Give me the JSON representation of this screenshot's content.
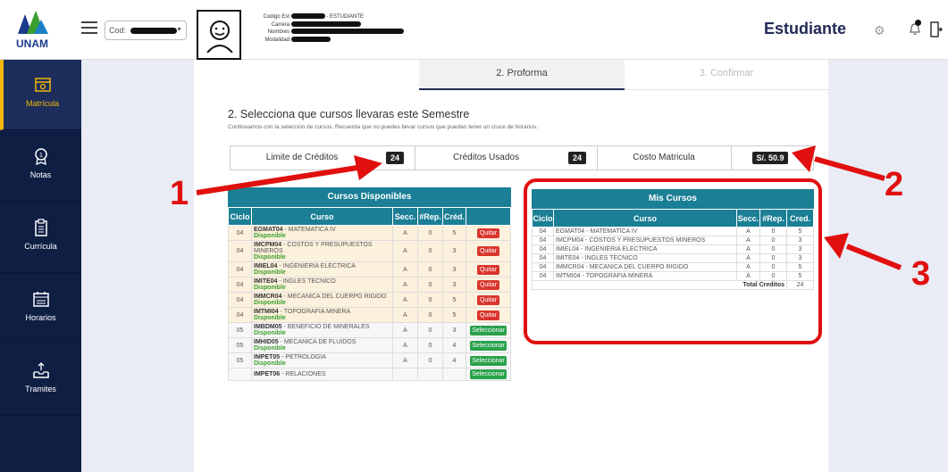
{
  "header": {
    "logo_text": "UNAM",
    "cod_label": "Cod:",
    "info": {
      "codigo_label": "Codigo Est",
      "codigo_suffix": "- ESTUDIANTE",
      "carrera_label": "Carrera",
      "nombres_label": "Nombres",
      "modalidad_label": "Modalidad"
    },
    "role": "Estudiante",
    "bell_count": "1"
  },
  "sidebar": {
    "items": [
      {
        "label": "Matrícula",
        "icon": "register-icon",
        "active": true
      },
      {
        "label": "Notas",
        "icon": "grade-medal-icon",
        "active": false
      },
      {
        "label": "Currícula",
        "icon": "clipboard-icon",
        "active": false
      },
      {
        "label": "Horarios",
        "icon": "calendar-icon",
        "active": false
      },
      {
        "label": "Tramites",
        "icon": "inbox-tray-icon",
        "active": false
      }
    ]
  },
  "steps": [
    "",
    "2. Proforma",
    "3. Confirmar"
  ],
  "section": {
    "title": "2. Selecciona que cursos llevaras este Semestre",
    "subtitle": "Continuamos con la seleccion de cursos. Recuerda que no puedes llevar cursos que puedan tener un cruce de horarios."
  },
  "credits": {
    "limit_label": "Limite de Créditos",
    "limit_value": "24",
    "used_label": "Créditos Usados",
    "used_value": "24",
    "cost_label": "Costo Matricula",
    "cost_value": "S/. 50.9"
  },
  "disponibles": {
    "title": "Cursos Disponibles",
    "columns": [
      "Ciclo",
      "Curso",
      "Secc.",
      "#Rep.",
      "Créd.",
      ""
    ],
    "status_text": "Disponible",
    "quitar_label": "Quitar",
    "select_label": "Seleccionar",
    "rows": [
      {
        "ciclo": "04",
        "code": "EGMAT04",
        "name": " - MATEMATICA IV",
        "secc": "A",
        "rep": "0",
        "cred": "5",
        "action": "Quitar"
      },
      {
        "ciclo": "04",
        "code": "IMCPM04",
        "name": " - COSTOS Y PRESUPUESTOS MINEROS",
        "secc": "A",
        "rep": "0",
        "cred": "3",
        "action": "Quitar"
      },
      {
        "ciclo": "04",
        "code": "IMIEL04",
        "name": " - INGENIERIA ELECTRICA",
        "secc": "A",
        "rep": "0",
        "cred": "3",
        "action": "Quitar"
      },
      {
        "ciclo": "04",
        "code": "IMITE04",
        "name": " - INGLES TECNICO",
        "secc": "A",
        "rep": "0",
        "cred": "3",
        "action": "Quitar"
      },
      {
        "ciclo": "04",
        "code": "IMMCR04",
        "name": " - MECANICA DEL CUERPO RIGIDO",
        "secc": "A",
        "rep": "0",
        "cred": "5",
        "action": "Quitar"
      },
      {
        "ciclo": "04",
        "code": "IMTMI04",
        "name": " - TOPOGRAFIA MINERA",
        "secc": "A",
        "rep": "0",
        "cred": "5",
        "action": "Quitar"
      },
      {
        "ciclo": "05",
        "code": "IMBDM05",
        "name": " - BENEFICIO DE MINERALES",
        "secc": "A",
        "rep": "0",
        "cred": "3",
        "action": "Seleccionar"
      },
      {
        "ciclo": "05",
        "code": "IMHID05",
        "name": " - MECANICA DE FLUIDOS",
        "secc": "A",
        "rep": "0",
        "cred": "4",
        "action": "Seleccionar"
      },
      {
        "ciclo": "05",
        "code": "IMPET05",
        "name": " - PETROLOGIA",
        "secc": "A",
        "rep": "0",
        "cred": "4",
        "action": "Seleccionar"
      },
      {
        "ciclo": "",
        "code": "IMPET06",
        "name": " - RELACIONES",
        "secc": "",
        "rep": "",
        "cred": "",
        "action": "Seleccionar"
      }
    ]
  },
  "mis_cursos": {
    "title": "Mis Cursos",
    "columns": [
      "Ciclo",
      "Curso",
      "Secc.",
      "#Rep.",
      "Cred."
    ],
    "rows": [
      {
        "ciclo": "04",
        "curso": "EGMAT04 - MATEMATICA IV",
        "secc": "A",
        "rep": "0",
        "cred": "5"
      },
      {
        "ciclo": "04",
        "curso": "IMCPM04 - COSTOS Y PRESUPUESTOS MINEROS",
        "secc": "A",
        "rep": "0",
        "cred": "3"
      },
      {
        "ciclo": "04",
        "curso": "IMIEL04 - INGENIERIA ELECTRICA",
        "secc": "A",
        "rep": "0",
        "cred": "3"
      },
      {
        "ciclo": "04",
        "curso": "IMITE04 - INGLES TECNICO",
        "secc": "A",
        "rep": "0",
        "cred": "3"
      },
      {
        "ciclo": "04",
        "curso": "IMMCR04 - MECANICA DEL CUERPO RIGIDO",
        "secc": "A",
        "rep": "0",
        "cred": "5"
      },
      {
        "ciclo": "04",
        "curso": "IMTMI04 - TOPOGRAFIA MINERA",
        "secc": "A",
        "rep": "0",
        "cred": "5"
      }
    ],
    "total_label": "Total Creditos",
    "total_value": "24"
  },
  "annotations": [
    "1",
    "2",
    "3"
  ],
  "colors": {
    "annotation": "#e0100f",
    "table_header": "#1b7f95",
    "sidebar": "#0f1f44",
    "active_accent": "#f2b705"
  }
}
